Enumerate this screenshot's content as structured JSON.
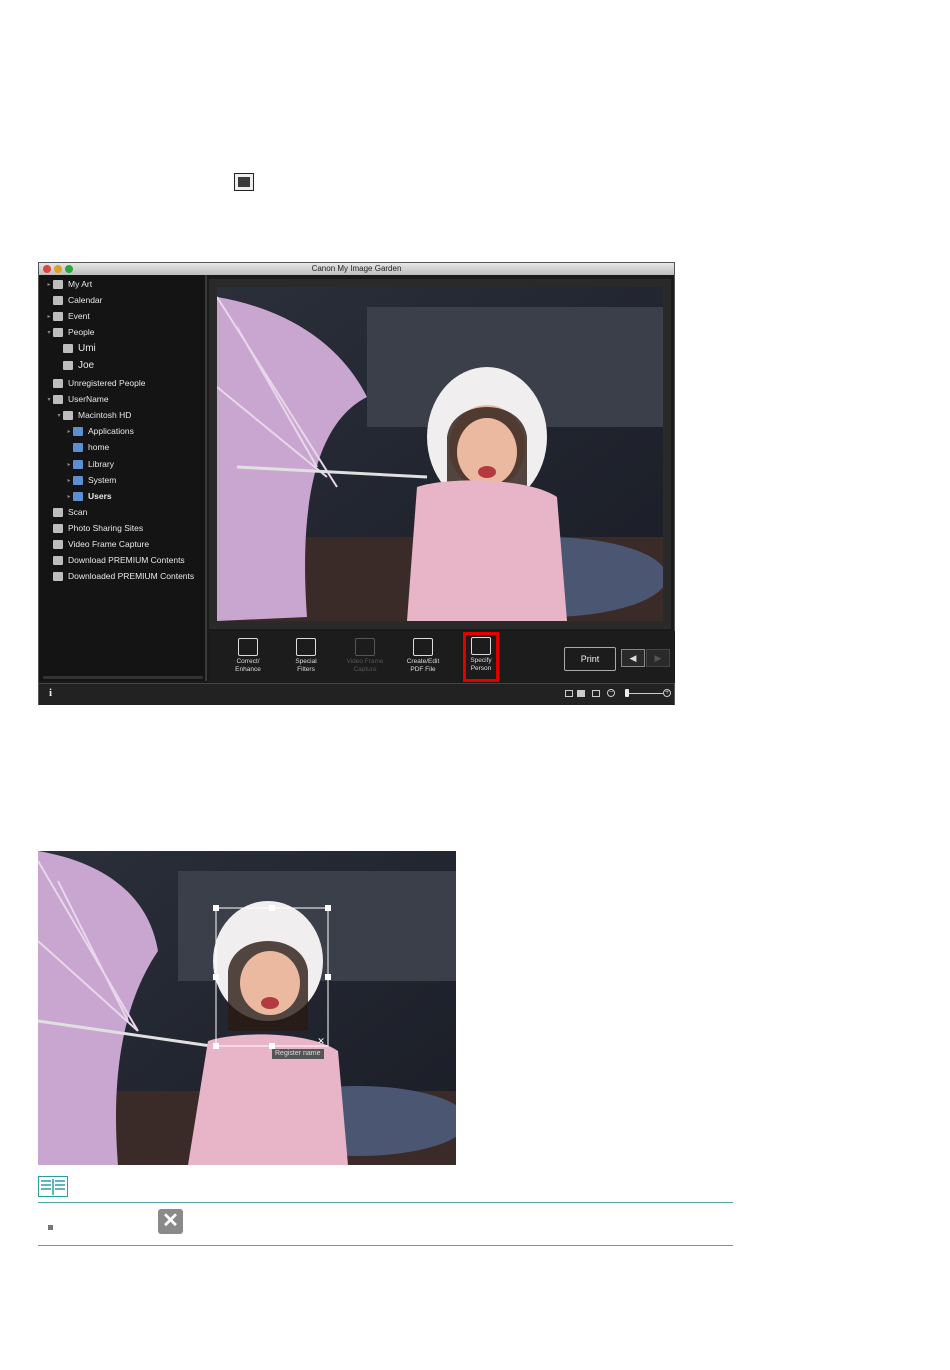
{
  "window": {
    "title": "Canon My Image Garden",
    "traffic_colors": [
      "#e0443e",
      "#dea123",
      "#27aa35"
    ]
  },
  "sidebar": {
    "items": [
      {
        "label": "My Art",
        "icon": "myart-icon",
        "tri": "▸"
      },
      {
        "label": "Calendar",
        "icon": "calendar-icon",
        "tri": ""
      },
      {
        "label": "Event",
        "icon": "event-icon",
        "tri": "▸"
      },
      {
        "label": "People",
        "icon": "people-icon",
        "tri": "▾"
      },
      {
        "label": "Umi",
        "icon": "person-icon",
        "tri": ""
      },
      {
        "label": "Joe",
        "icon": "person-icon",
        "tri": ""
      },
      {
        "label": "Unregistered People",
        "icon": "unregistered-people-icon",
        "tri": ""
      },
      {
        "label": "UserName",
        "icon": "computer-icon",
        "tri": "▾"
      },
      {
        "label": "Macintosh HD",
        "icon": "drive-icon",
        "tri": "▾"
      },
      {
        "label": "Applications",
        "icon": "folder-icon",
        "tri": "▸"
      },
      {
        "label": "home",
        "icon": "folder-icon",
        "tri": ""
      },
      {
        "label": "Library",
        "icon": "folder-icon",
        "tri": "▸"
      },
      {
        "label": "System",
        "icon": "folder-icon",
        "tri": "▸"
      },
      {
        "label": "Users",
        "icon": "folder-icon",
        "tri": "▸"
      },
      {
        "label": "Scan",
        "icon": "scan-icon",
        "tri": ""
      },
      {
        "label": "Photo Sharing Sites",
        "icon": "photo-sharing-icon",
        "tri": ""
      },
      {
        "label": "Video Frame Capture",
        "icon": "video-frame-icon",
        "tri": ""
      },
      {
        "label": "Download PREMIUM Contents",
        "icon": "download-icon",
        "tri": ""
      },
      {
        "label": "Downloaded PREMIUM Contents",
        "icon": "downloaded-folder-icon",
        "tri": ""
      }
    ]
  },
  "toolbar": {
    "correct": "Correct/\nEnhance",
    "special": "Special\nFilters",
    "video": "Video Frame\nCapture",
    "pdf": "Create/Edit\nPDF File",
    "specify": "Specify\nPerson",
    "print": "Print",
    "prev": "◀",
    "next": "▶"
  },
  "statusbar": {
    "info": "i",
    "zoom_out": "−",
    "zoom_in": "+"
  },
  "face_frame": {
    "register_label": "Register name",
    "close": "✕"
  },
  "note": {
    "close_glyph": "✕"
  },
  "highlight_color": "#e00000",
  "accent_line_color": "#4aa8a8"
}
